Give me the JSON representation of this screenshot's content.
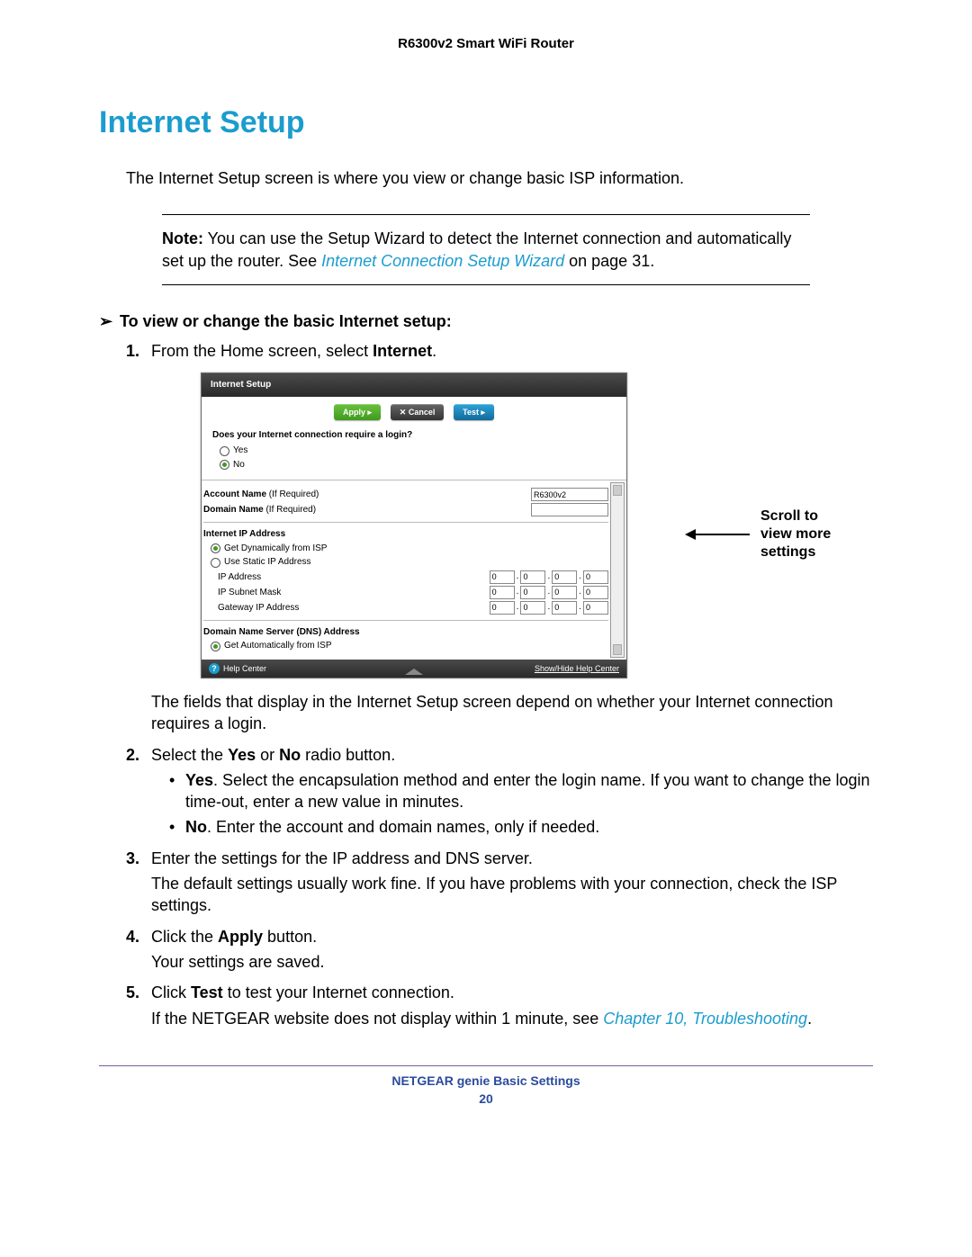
{
  "header": {
    "product": "R6300v2 Smart WiFi Router"
  },
  "section": {
    "title": "Internet Setup"
  },
  "intro": "The Internet Setup screen is where you view or change basic ISP information.",
  "note": {
    "label": "Note:",
    "text_before": " You can use the Setup Wizard to detect the Internet connection and automatically set up the router. See ",
    "link": "Internet Connection Setup Wizard",
    "text_after": " on page 31."
  },
  "procedure": {
    "arrow_glyph": "➢",
    "heading": "To view or change the basic Internet setup:",
    "steps": [
      {
        "num": "1.",
        "parts": [
          {
            "t": "From the Home screen, select "
          },
          {
            "t": "Internet",
            "strong": true
          },
          {
            "t": "."
          }
        ]
      },
      {
        "num": "",
        "after_shot": true,
        "plain": "The fields that display in the Internet Setup screen depend on whether your Internet connection requires a login."
      },
      {
        "num": "2.",
        "parts": [
          {
            "t": "Select the "
          },
          {
            "t": "Yes",
            "strong": true
          },
          {
            "t": " or "
          },
          {
            "t": "No",
            "strong": true
          },
          {
            "t": " radio button."
          }
        ],
        "bullets": [
          {
            "parts": [
              {
                "t": "Yes",
                "strong": true
              },
              {
                "t": ". Select the encapsulation method and enter the login name. If you want to change the login time-out, enter a new value in minutes."
              }
            ]
          },
          {
            "parts": [
              {
                "t": "No",
                "strong": true
              },
              {
                "t": ". Enter the account and domain names, only if needed."
              }
            ]
          }
        ]
      },
      {
        "num": "3.",
        "plain": "Enter the settings for the IP address and DNS server.",
        "follow": "The default settings usually work fine. If you have problems with your connection, check the ISP settings."
      },
      {
        "num": "4.",
        "parts": [
          {
            "t": "Click the "
          },
          {
            "t": "Apply",
            "strong": true
          },
          {
            "t": " button."
          }
        ],
        "follow": "Your settings are saved."
      },
      {
        "num": "5.",
        "parts": [
          {
            "t": "Click "
          },
          {
            "t": "Test",
            "strong": true
          },
          {
            "t": " to test your Internet connection."
          }
        ],
        "follow_parts": [
          {
            "t": "If the NETGEAR website does not display within 1 minute, see "
          },
          {
            "t": "Chapter 10, Troubleshooting",
            "link": true
          },
          {
            "t": "."
          }
        ]
      }
    ]
  },
  "screenshot": {
    "title": "Internet Setup",
    "buttons": {
      "apply": "Apply  ▸",
      "cancel": "✕ Cancel",
      "test": "Test  ▸"
    },
    "question": "Does your Internet connection require a login?",
    "yes": "Yes",
    "no": "No",
    "account_label": "Account Name",
    "if_required": "  (If Required)",
    "account_value": "R6300v2",
    "domain_label": "Domain Name",
    "ip_section": "Internet IP Address",
    "ip_dynamic": "Get Dynamically from ISP",
    "ip_static": "Use Static IP Address",
    "ip_address": "IP Address",
    "subnet": "IP Subnet Mask",
    "gateway": "Gateway IP Address",
    "ip_zero": "0",
    "dns_section": "Domain Name Server (DNS) Address",
    "dns_auto": "Get Automatically from ISP",
    "help": "Help Center",
    "showhide": "Show/Hide Help Center"
  },
  "callout": {
    "l1": "Scroll to",
    "l2": "view more",
    "l3": "settings"
  },
  "footer": {
    "title": "NETGEAR genie Basic Settings",
    "page": "20"
  }
}
